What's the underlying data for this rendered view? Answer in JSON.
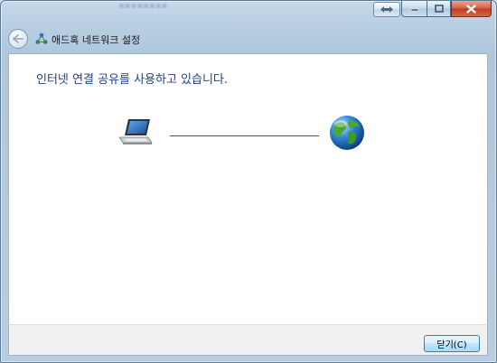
{
  "window": {
    "title": "애드혹 네트워크 설정"
  },
  "main": {
    "heading": "인터넷 연결 공유를 사용하고 있습니다."
  },
  "footer": {
    "close_label": "닫기(C)"
  },
  "icons": {
    "back": "back-arrow-icon",
    "app": "network-icon",
    "laptop": "laptop-icon",
    "globe": "globe-icon",
    "minimize": "minimize-icon",
    "maximize": "maximize-icon",
    "close": "close-icon",
    "resize": "resize-arrows-icon"
  },
  "colors": {
    "heading": "#1c3f94",
    "close_button_red": "#c0391e",
    "frame_glass": "#b9cfe2"
  }
}
